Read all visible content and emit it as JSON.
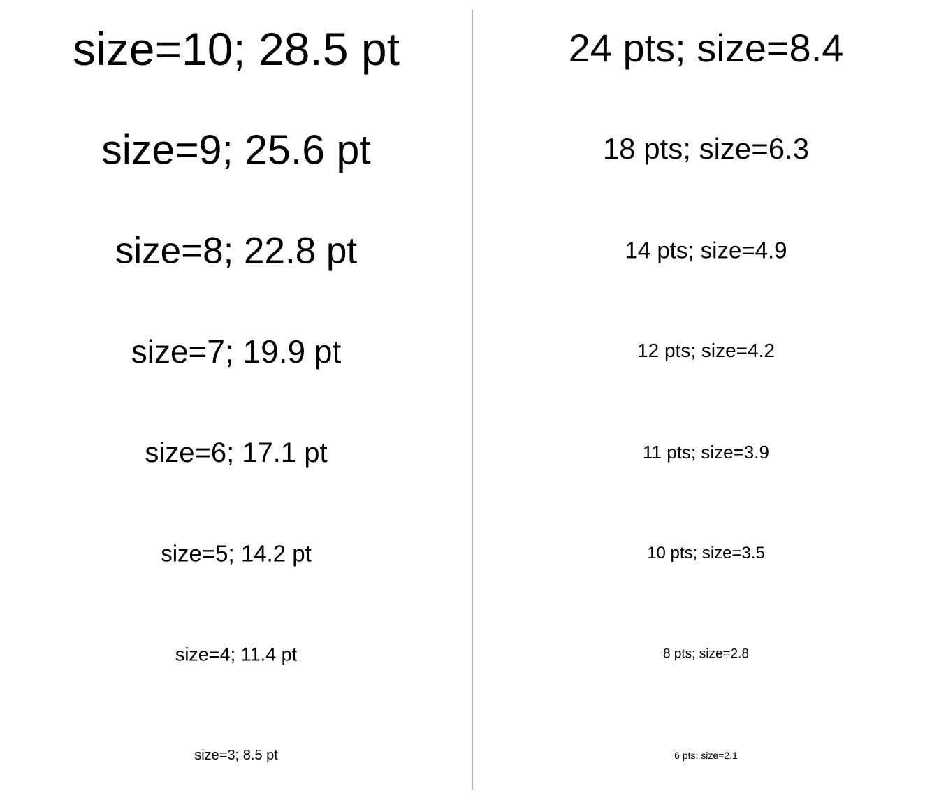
{
  "left_column": {
    "samples": [
      {
        "text": "size=10; 28.5 pt"
      },
      {
        "text": "size=9; 25.6 pt"
      },
      {
        "text": "size=8; 22.8 pt"
      },
      {
        "text": "size=7; 19.9 pt"
      },
      {
        "text": "size=6; 17.1 pt"
      },
      {
        "text": "size=5; 14.2 pt"
      },
      {
        "text": "size=4; 11.4 pt"
      },
      {
        "text": "size=3; 8.5 pt"
      }
    ]
  },
  "right_column": {
    "samples": [
      {
        "text": "24 pts; size=8.4"
      },
      {
        "text": "18 pts; size=6.3"
      },
      {
        "text": "14 pts; size=4.9"
      },
      {
        "text": "12 pts; size=4.2"
      },
      {
        "text": "11 pts; size=3.9"
      },
      {
        "text": "10 pts; size=3.5"
      },
      {
        "text": "8 pts; size=2.8"
      },
      {
        "text": "6 pts; size=2.1"
      }
    ]
  },
  "colors": {
    "background": "#ffffff",
    "text": "#000000",
    "divider": "#b4b4b4"
  }
}
